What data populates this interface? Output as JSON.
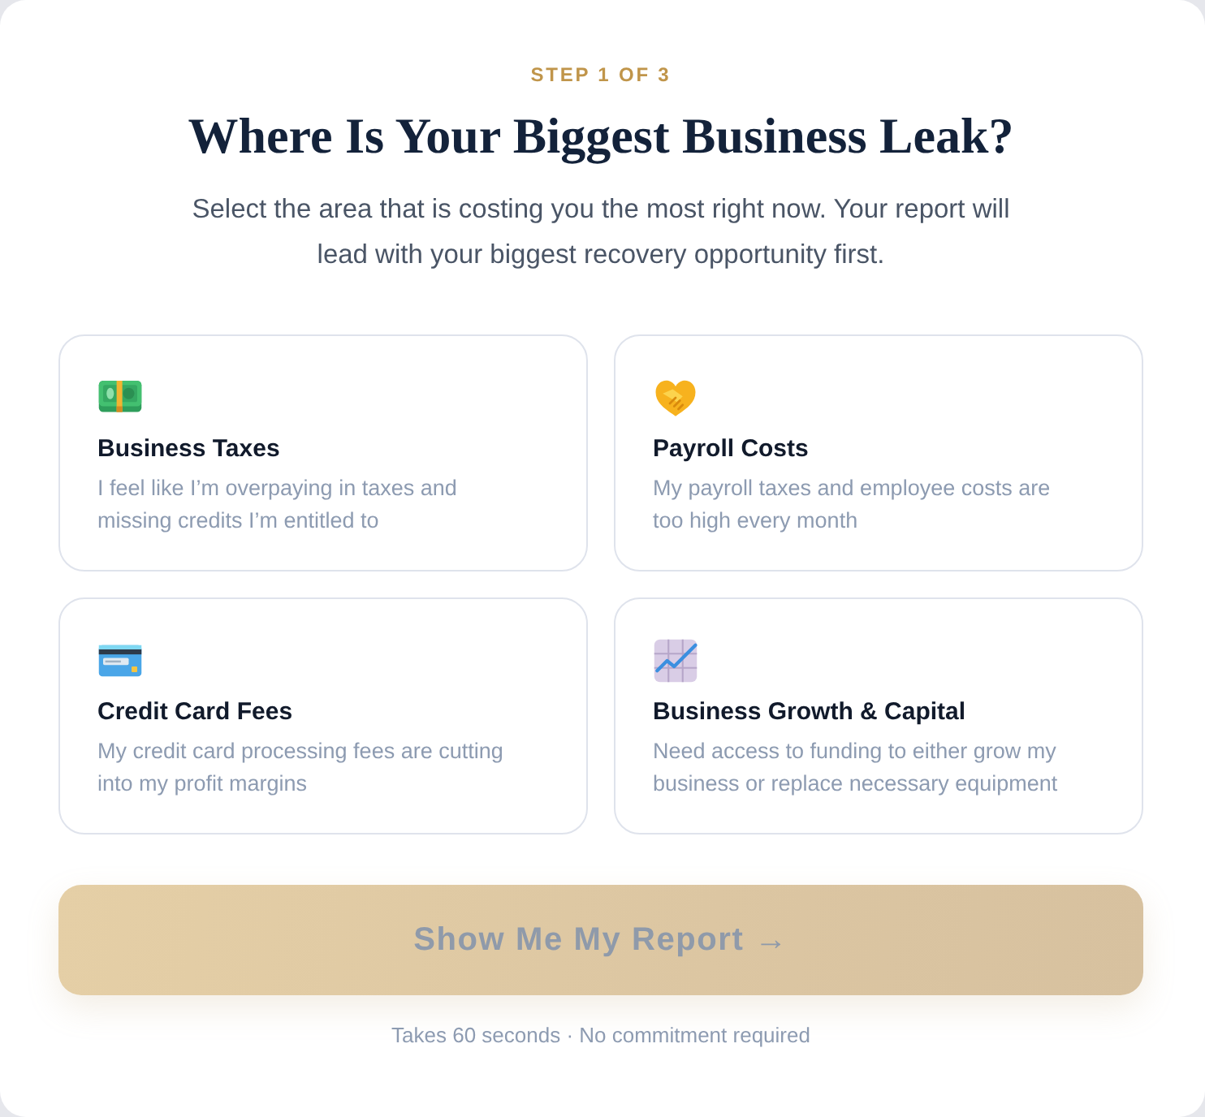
{
  "step": "STEP 1 OF 3",
  "title": "Where Is Your Biggest Business Leak?",
  "subtitle": "Select the area that is costing you the most right now. Your report will lead with your biggest recovery opportunity first.",
  "options": [
    {
      "title": "Business Taxes",
      "description": "I feel like I’m overpaying in taxes and missing credits I’m entitled to",
      "selected": false
    },
    {
      "title": "Payroll Costs",
      "description": "My payroll taxes and employee costs are too high every month",
      "selected": false
    },
    {
      "title": "Credit Card Fees",
      "description": "My credit card processing fees are cutting into my profit margins",
      "selected": false
    },
    {
      "title": "Business Growth & Capital",
      "description": "Need access to funding to either grow my business or replace necessary equipment",
      "selected": false
    }
  ],
  "submit_button": {
    "label": "Show Me My Report →",
    "disabled": true
  },
  "footnote": "Takes 60 seconds · No commitment required"
}
